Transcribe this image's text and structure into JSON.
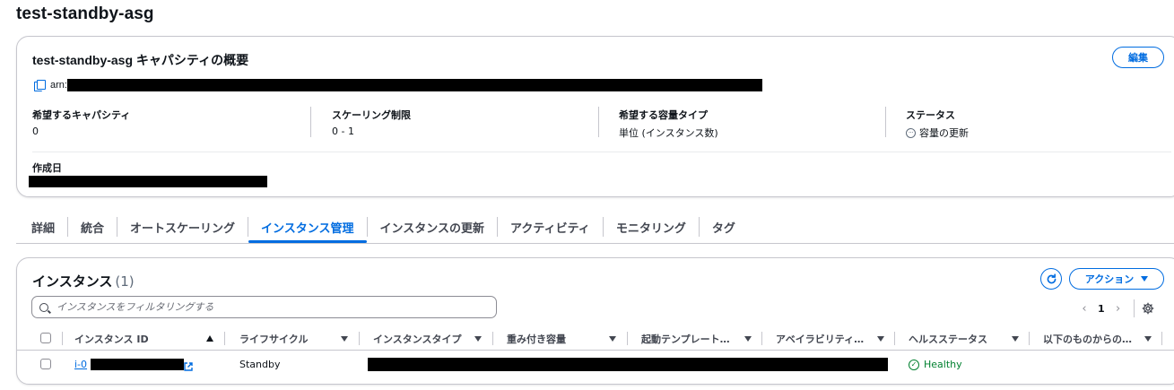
{
  "page": {
    "title": "test-standby-asg"
  },
  "summary": {
    "title": "test-standby-asg キャパシティの概要",
    "edit_label": "編集",
    "arn_label": "arn:",
    "fields": [
      {
        "key": "希望するキャパシティ",
        "value": "0"
      },
      {
        "key": "スケーリング制限",
        "value": "0 - 1"
      },
      {
        "key": "希望する容量タイプ",
        "value": "単位 (インスタンス数)"
      },
      {
        "key": "ステータス",
        "value": "容量の更新"
      }
    ],
    "created_key": "作成日"
  },
  "tabs": [
    {
      "label": "詳細"
    },
    {
      "label": "統合"
    },
    {
      "label": "オートスケーリング"
    },
    {
      "label": "インスタンス管理",
      "active": true
    },
    {
      "label": "インスタンスの更新"
    },
    {
      "label": "アクティビティ"
    },
    {
      "label": "モニタリング"
    },
    {
      "label": "タグ"
    }
  ],
  "instances": {
    "title": "インスタンス",
    "count": "(1)",
    "action_label": "アクション",
    "search_placeholder": "インスタンスをフィルタリングする",
    "page_number": "1",
    "columns": [
      "インスタンス ID",
      "ライフサイクル",
      "インスタンスタイプ",
      "重み付き容量",
      "起動テンプレート…",
      "アベイラビリティ…",
      "ヘルスステータス",
      "以下のものからの…"
    ],
    "rows": [
      {
        "instance_id": "i-0",
        "lifecycle": "Standby",
        "health": "Healthy"
      }
    ]
  },
  "colors": {
    "accent": "#006ce0",
    "healthy": "#00802f",
    "border": "#c6c6cd"
  }
}
